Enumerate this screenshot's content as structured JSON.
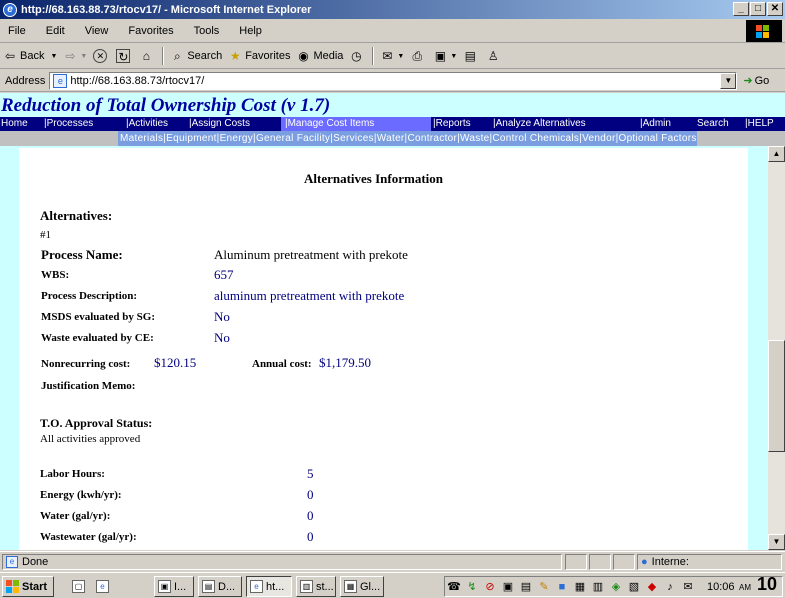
{
  "window": {
    "title": "http://68.163.88.73/rtocv17/ - Microsoft Internet Explorer",
    "minimize": "_",
    "maximize": "□",
    "close": "✕"
  },
  "menu": [
    "File",
    "Edit",
    "View",
    "Favorites",
    "Tools",
    "Help"
  ],
  "toolbar": {
    "back": "Back",
    "search": "Search",
    "favorites": "Favorites",
    "media": "Media"
  },
  "address": {
    "label": "Address",
    "url": "http://68.163.88.73/rtocv17/",
    "go": "Go"
  },
  "app": {
    "title": "Reduction of Total Ownership Cost (v 1.7)",
    "nav": [
      "Home",
      "|Processes",
      "|Activities",
      "|Assign Costs",
      "|Manage Cost Items",
      "|Reports",
      "|Analyze Alternatives",
      "|Admin",
      "Search",
      "|HELP"
    ],
    "active_nav_index": 4,
    "subnav": "Materials|Equipment|Energy|General Facility|Services|Water|Contractor|Waste|Control Chemicals|Vendor|Optional Factors"
  },
  "content": {
    "heading": "Alternatives Information",
    "section_label": "Alternatives:",
    "item_number": "#1",
    "process_name_label": "Process Name:",
    "process_name_value": "Aluminum pretreatment with prekote",
    "wbs_label": "WBS:",
    "wbs_value": "657",
    "process_desc_label": "Process Description:",
    "process_desc_value": "aluminum pretreatment with prekote",
    "msds_label": "MSDS evaluated by SG:",
    "msds_value": "No",
    "waste_label": "Waste evaluated by CE:",
    "waste_value": "No",
    "nonrecurring_label": "Nonrecurring cost:",
    "nonrecurring_value": "$120.15",
    "annual_label": "Annual cost:",
    "annual_value": "$1,179.50",
    "justification_label": "Justification Memo:",
    "approval_label": "T.O. Approval Status:",
    "approval_value": "All activities approved",
    "labor_label": "Labor Hours:",
    "labor_value": "5",
    "energy_label": "Energy (kwh/yr):",
    "energy_value": "0",
    "water_label": "Water (gal/yr):",
    "water_value": "0",
    "wastewater_label": "Wastewater (gal/yr):",
    "wastewater_value": "0"
  },
  "status": {
    "text": "Done",
    "zone": "Interne:"
  },
  "taskbar": {
    "start": "Start",
    "buttons": [
      "I...",
      "D...",
      "ht...",
      "st...",
      "Gl..."
    ],
    "clock": "10:06",
    "clock_suffix": "AM",
    "overlay": "10"
  }
}
